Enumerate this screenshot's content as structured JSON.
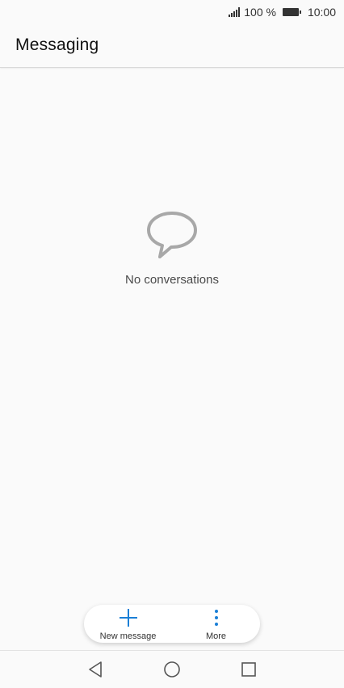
{
  "status_bar": {
    "battery_percent": "100 %",
    "time": "10:00",
    "icons": [
      "signal-icon",
      "battery-icon"
    ]
  },
  "app_bar": {
    "title": "Messaging"
  },
  "empty_state": {
    "icon": "chat-bubble-icon",
    "text": "No conversations"
  },
  "actions": {
    "new_message_label": "New message",
    "new_message_icon": "plus-icon",
    "more_label": "More",
    "more_icon": "more-vertical-icon"
  },
  "nav_bar": {
    "icons": [
      "back-icon",
      "home-icon",
      "recents-icon"
    ]
  },
  "colors": {
    "accent": "#1a7fd6",
    "background": "#fafafa",
    "icon_gray": "#a8a8a8"
  }
}
